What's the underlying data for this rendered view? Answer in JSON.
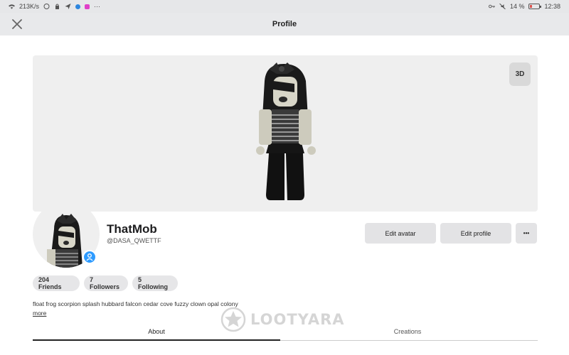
{
  "status_bar": {
    "speed": "213K/s",
    "battery": "14 %",
    "time": "12:38"
  },
  "app_bar": {
    "title": "Profile",
    "close_icon": "close-icon"
  },
  "banner": {
    "view_3d_label": "3D"
  },
  "profile": {
    "display_name": "ThatMob",
    "username": "@DASA_QWETTF",
    "edit_avatar_label": "Edit avatar",
    "edit_profile_label": "Edit profile",
    "more_label": "•••"
  },
  "stats": {
    "friends": "204 Friends",
    "followers": "7 Followers",
    "following": "5 Following"
  },
  "bio": {
    "text": "float frog scorpion splash hubbard falcon cedar cove fuzzy clown opal colony",
    "more_label": "more"
  },
  "tabs": [
    {
      "label": "About",
      "active": true
    },
    {
      "label": "Creations",
      "active": false
    }
  ],
  "watermark": {
    "text": "LOOTYARA"
  },
  "colors": {
    "presence_blue": "#2e9bff",
    "button_gray": "#e3e3e5",
    "banner_bg": "#efefef"
  }
}
